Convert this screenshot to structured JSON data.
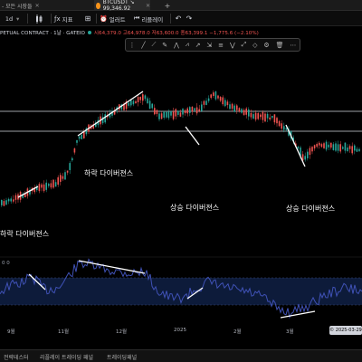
{
  "tabs": [
    {
      "label": "- 모든 시장들",
      "active": false
    },
    {
      "label": "BTCUSDT ↘ 99,346.92",
      "active": true
    }
  ],
  "toolbar": {
    "interval": "1d",
    "chart_type": "캔들",
    "indicators_label": "지표",
    "alert_label": "얼러트",
    "replay_label": "리플레이"
  },
  "legend": {
    "symbol": "PETUAL CONTRACT · 1날 · GATEIO",
    "values": "시64,379.0  고64,978.0  저63,600.0  종63,399.1  −1,775.6 (−2.10%)"
  },
  "annotations": {
    "bearish_div_1": "하락 다이버젼스",
    "bearish_div_2": "하락 다이버젼스",
    "bullish_div_1": "상승 다이버젼스",
    "bullish_div_2": "상승 다이버젼스"
  },
  "oscillator_label": "0 0",
  "x_axis": {
    "ticks": [
      {
        "label": "9월",
        "pos": 0.02
      },
      {
        "label": "11월",
        "pos": 0.16
      },
      {
        "label": "12월",
        "pos": 0.32
      },
      {
        "label": "2025",
        "pos": 0.48
      },
      {
        "label": "2월",
        "pos": 0.645
      },
      {
        "label": "3월",
        "pos": 0.79
      }
    ],
    "current_date": "© 2025-03-29"
  },
  "bottom_tabs": [
    "전략테스터",
    "리플레이 트레이딩 패널",
    "트레이딩패널"
  ],
  "colors": {
    "up": "#26a69a",
    "down": "#ef5350",
    "osc": "#3f51b5",
    "annotation": "#ffffff"
  }
}
